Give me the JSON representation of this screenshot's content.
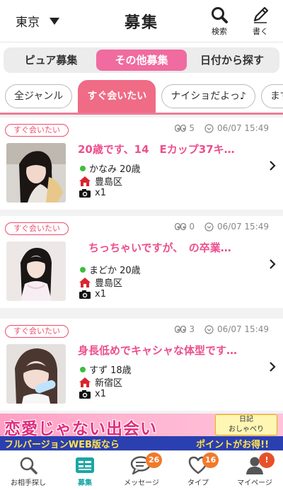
{
  "header": {
    "region": "東京",
    "title": "募集",
    "search_label": "検索",
    "write_label": "書く"
  },
  "segments": [
    {
      "label": "ピュア募集",
      "active": false
    },
    {
      "label": "その他募集",
      "active": true
    },
    {
      "label": "日付から探す",
      "active": false
    }
  ],
  "genres": [
    {
      "label": "全ジャンル",
      "active": false
    },
    {
      "label": "すぐ会いたい",
      "active": true
    },
    {
      "label": "ナイショだよっ♪",
      "active": false
    },
    {
      "label": "まずは",
      "active": false
    }
  ],
  "posts": [
    {
      "badge": "すぐ会いたい",
      "views": "5",
      "date": "06/07 15:49",
      "title": "20歳です、14　Eカップ37キ…",
      "name": "かなみ 20歳",
      "area": "豊島区",
      "photos": "x1"
    },
    {
      "badge": "すぐ会いたい",
      "views": "0",
      "date": "06/07 15:49",
      "title": "　ちっちゃいですが、　の卒業…",
      "name": "まどか 20歳",
      "area": "豊島区",
      "photos": "x1"
    },
    {
      "badge": "すぐ会いたい",
      "views": "3",
      "date": "06/07 15:49",
      "title": "身長低めでキャシャな体型です…",
      "name": "すず 18歳",
      "area": "新宿区",
      "photos": "x1"
    }
  ],
  "banner": {
    "main": "恋愛じゃない出会い",
    "sub": "フルバージョンWEB版なら",
    "sub2": "ポイントがお得!!",
    "box_line1": "日記",
    "box_line2": "おしゃべり"
  },
  "nav": [
    {
      "label": "お相手探し",
      "icon": "search-icon",
      "badge": ""
    },
    {
      "label": "募集",
      "icon": "board-icon",
      "badge": ""
    },
    {
      "label": "メッセージ",
      "icon": "chat-icon",
      "badge": "26"
    },
    {
      "label": "タイプ",
      "icon": "heart-icon",
      "badge": "16"
    },
    {
      "label": "マイページ",
      "icon": "user-icon",
      "badge": "!"
    }
  ],
  "colors": {
    "accent_pink": "#f06ba0",
    "badge_red": "#ef4b6a",
    "nav_active": "#1aa6a6",
    "online_green": "#3dbd3d"
  }
}
